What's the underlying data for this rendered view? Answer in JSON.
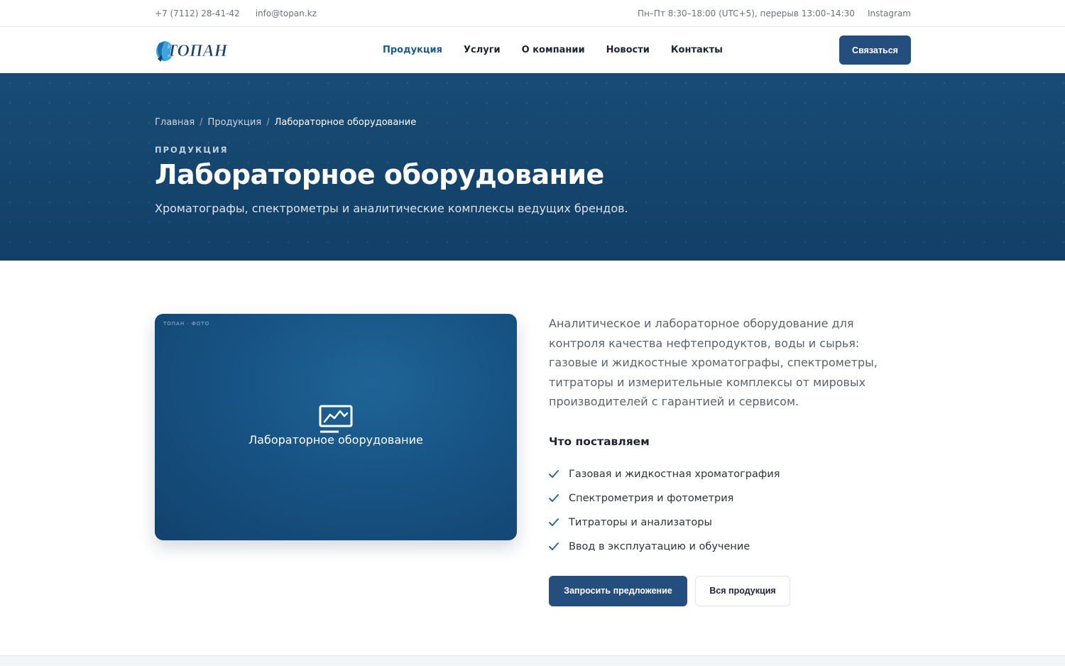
{
  "topbar": {
    "phone": "+7 (7112) 28-41-42",
    "email": "info@topan.kz",
    "hours": "Пн–Пт 8:30–18:00 (UTC+5), перерыв 13:00–14:30",
    "instagram": "Instagram"
  },
  "header": {
    "logo_text": "ТОПАН",
    "nav": [
      {
        "label": "Продукция",
        "active": true
      },
      {
        "label": "Услуги",
        "active": false
      },
      {
        "label": "О компании",
        "active": false
      },
      {
        "label": "Новости",
        "active": false
      },
      {
        "label": "Контакты",
        "active": false
      }
    ],
    "contact_button": "Связаться"
  },
  "hero": {
    "breadcrumb": [
      "Главная",
      "Продукция",
      "Лабораторное оборудование"
    ],
    "breadcrumb_separator": "/",
    "eyebrow": "ПРОДУКЦИЯ",
    "title": "Лабораторное оборудование",
    "lead": "Хроматографы, спектрометры и аналитические комплексы ведущих брендов."
  },
  "photo": {
    "tag": "ТОПАН · ФОТО",
    "icon": "monitor-chart-icon",
    "label": "Лабораторное оборудование"
  },
  "content": {
    "description": "Аналитическое и лабораторное оборудование для контроля качества нефтепродуктов, воды и сырья: газовые и жидкостные хроматографы, спектрометры, титраторы и измерительные комплексы от мировых производителей с гарантией и сервисом.",
    "subhead": "Что поставляем",
    "features": [
      "Газовая и жидкостная хроматография",
      "Спектрометрия и фотометрия",
      "Титраторы и анализаторы",
      "Ввод в эксплуатацию и обучение"
    ],
    "primary_button": "Запросить предложение",
    "secondary_button": "Вся продукция"
  },
  "colors": {
    "brand": "#244e7d",
    "hero_bg": "#184c76",
    "active_nav": "#1e5a8c",
    "check": "#2a6aa0"
  }
}
